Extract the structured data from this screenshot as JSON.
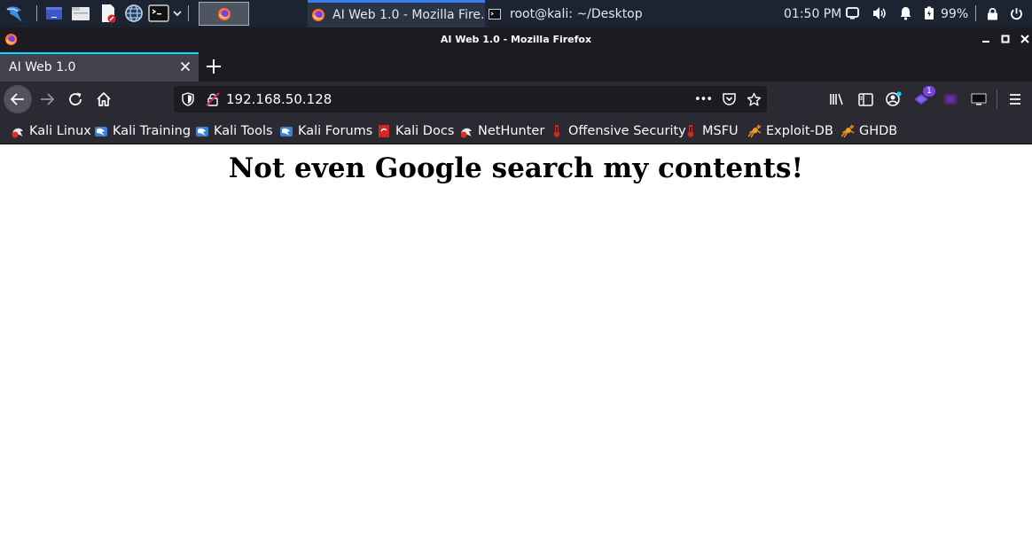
{
  "panel": {
    "tasks": [
      {
        "label": "AI Web 1.0 - Mozilla Fire..."
      },
      {
        "label": "root@kali: ~/Desktop"
      }
    ],
    "clock": "01:50 PM",
    "battery": "99%"
  },
  "window": {
    "title": "AI Web 1.0 - Mozilla Firefox"
  },
  "tab": {
    "label": "AI Web 1.0"
  },
  "urlbar": {
    "url": "192.168.50.128",
    "more_label": "•••"
  },
  "extension_badge": "1",
  "bookmarks": [
    {
      "label": "Kali Linux"
    },
    {
      "label": "Kali Training"
    },
    {
      "label": "Kali Tools"
    },
    {
      "label": "Kali Forums"
    },
    {
      "label": "Kali Docs"
    },
    {
      "label": "NetHunter"
    },
    {
      "label": "Offensive Security"
    },
    {
      "label": "MSFU"
    },
    {
      "label": "Exploit-DB"
    },
    {
      "label": "GHDB"
    }
  ],
  "page": {
    "heading": "Not even Google search my contents!"
  },
  "colors": {
    "panel_bg": "#1c2431",
    "tab_accent": "#00ddff",
    "toolbar_bg": "#2b2a33",
    "titlebar_bg": "#1c1b22"
  }
}
